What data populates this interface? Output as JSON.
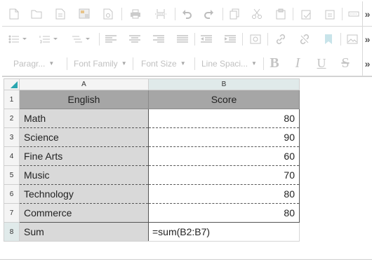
{
  "toolbar": {
    "row1_icons": [
      "new-document-icon",
      "open-folder-icon",
      "template-icon",
      "image-gallery-icon",
      "preview-icon",
      "print-icon",
      "page-break-icon",
      "undo-icon",
      "redo-icon",
      "copy-icon",
      "cut-icon",
      "paste-icon",
      "paste-text-icon",
      "paste-word-icon",
      "horizontal-rule-icon"
    ],
    "row2_icons": [
      "bulleted-list-icon",
      "numbered-list-icon",
      "multilevel-list-icon",
      "align-left-icon",
      "align-center-icon",
      "align-right-icon",
      "justify-icon",
      "outdent-icon",
      "indent-icon",
      "find-replace-icon",
      "link-icon",
      "unlink-icon",
      "bookmark-icon",
      "insert-image-icon"
    ],
    "paragraph": "Paragr...",
    "font_family": "Font Family",
    "font_size": "Font Size",
    "line_spacing": "Line Spaci...",
    "bold": "B",
    "italic": "I",
    "underline": "U",
    "strikethrough": "S",
    "more": "»"
  },
  "sheet": {
    "columns": [
      "A",
      "B"
    ],
    "row_numbers": [
      "1",
      "2",
      "3",
      "4",
      "5",
      "6",
      "7",
      "8"
    ],
    "header": [
      "English",
      "Score"
    ],
    "rows": [
      {
        "subject": "Math",
        "score": "80"
      },
      {
        "subject": "Science",
        "score": "90"
      },
      {
        "subject": "Fine Arts",
        "score": "60"
      },
      {
        "subject": "Music",
        "score": "70"
      },
      {
        "subject": "Technology",
        "score": "80"
      },
      {
        "subject": "Commerce",
        "score": "80"
      }
    ],
    "sum_label": "Sum",
    "sum_formula": "=sum(B2:B7)"
  },
  "colors": {
    "header_fill": "#a6a6a6",
    "label_fill": "#d9d9d9",
    "accent": "#2aa6b0",
    "disabled_icon": "#c4c4c4"
  }
}
